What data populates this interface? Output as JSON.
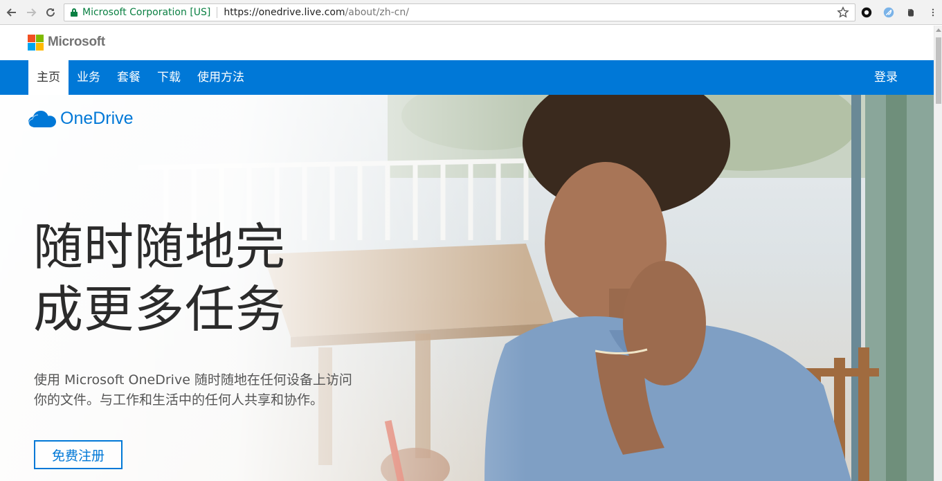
{
  "browser": {
    "ev_certificate": "Microsoft Corporation [US]",
    "url_scheme": "https://",
    "url_host": "onedrive.live.com",
    "url_path": "/about/zh-cn/"
  },
  "header": {
    "brand": "Microsoft",
    "logo_colors": [
      "#f25022",
      "#7fba00",
      "#00a4ef",
      "#ffb900"
    ]
  },
  "nav": {
    "items": [
      {
        "label": "主页",
        "active": true
      },
      {
        "label": "业务"
      },
      {
        "label": "套餐"
      },
      {
        "label": "下载"
      },
      {
        "label": "使用方法"
      }
    ],
    "signin": "登录",
    "accent": "#0078d7"
  },
  "hero": {
    "product": "OneDrive",
    "headline_line1": "随时随地完",
    "headline_line2": "成更多任务",
    "subtext": "使用 Microsoft OneDrive 随时随地在任何设备上访问你的文件。与工作和生活中的任何人共享和协作。",
    "cta": "免费注册"
  }
}
